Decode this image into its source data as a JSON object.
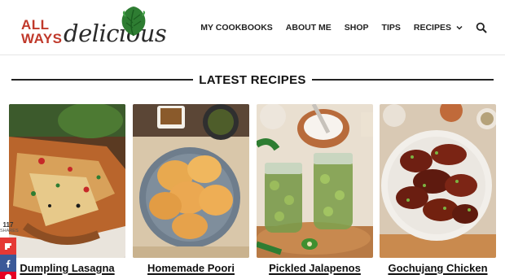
{
  "logo": {
    "line1": "ALL",
    "line2": "WAYS",
    "script": "delicious"
  },
  "nav": {
    "items": [
      {
        "label": "MY COOKBOOKS"
      },
      {
        "label": "ABOUT ME"
      },
      {
        "label": "SHOP"
      },
      {
        "label": "TIPS"
      },
      {
        "label": "RECIPES"
      }
    ],
    "search_icon": "search-icon",
    "dropdown_icon": "chevron-down-icon"
  },
  "section": {
    "title": "LATEST RECIPES"
  },
  "recipes": [
    {
      "title": "Dumpling Lasagna"
    },
    {
      "title": "Homemade Poori"
    },
    {
      "title": "Pickled Jalapenos"
    },
    {
      "title": "Gochujang Chicken"
    }
  ],
  "share": {
    "count": "117",
    "label": "SHARES",
    "buttons": [
      "flipboard-icon",
      "facebook-icon",
      "pinterest-icon"
    ]
  },
  "colors": {
    "brand_red": "#c0392b",
    "leaf_green": "#2e7d32",
    "flipboard": "#e53935",
    "facebook": "#3b5998",
    "pinterest": "#e60023"
  }
}
